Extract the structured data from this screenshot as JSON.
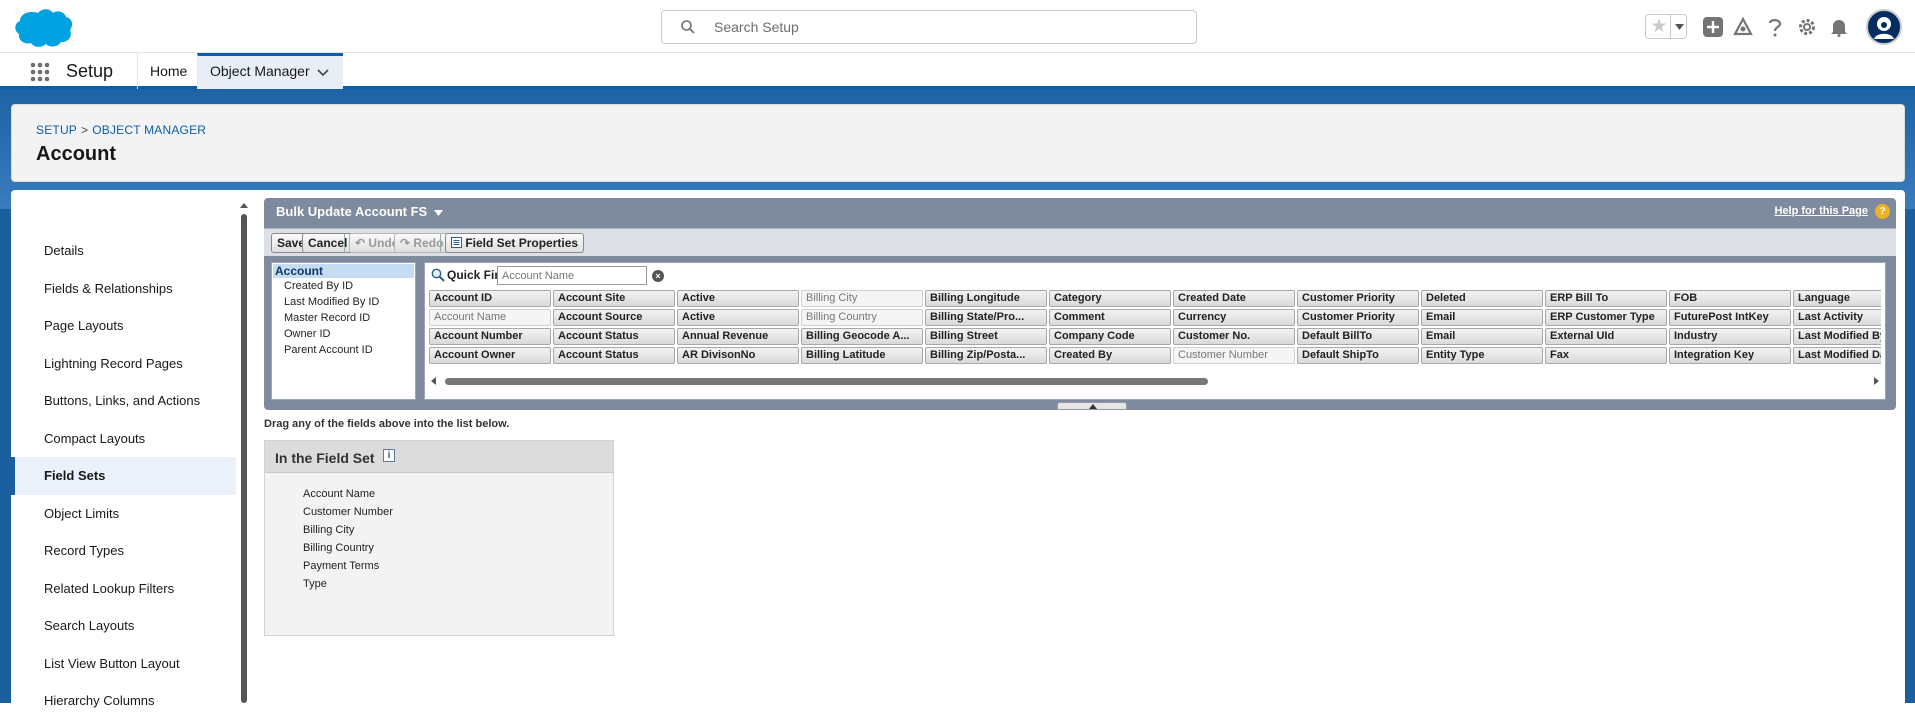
{
  "header": {
    "search_placeholder": "Search Setup"
  },
  "context": {
    "app_name": "Setup",
    "tabs": [
      {
        "label": "Home"
      },
      {
        "label": "Object Manager"
      }
    ]
  },
  "page": {
    "breadcrumb": [
      "SETUP",
      "OBJECT MANAGER"
    ],
    "breadcrumb_separator": ">",
    "title": "Account"
  },
  "sidebar": {
    "items": [
      {
        "label": "Details"
      },
      {
        "label": "Fields & Relationships"
      },
      {
        "label": "Page Layouts"
      },
      {
        "label": "Lightning Record Pages"
      },
      {
        "label": "Buttons, Links, and Actions"
      },
      {
        "label": "Compact Layouts"
      },
      {
        "label": "Field Sets"
      },
      {
        "label": "Object Limits"
      },
      {
        "label": "Record Types"
      },
      {
        "label": "Related Lookup Filters"
      },
      {
        "label": "Search Layouts"
      },
      {
        "label": "List View Button Layout"
      },
      {
        "label": "Hierarchy Columns"
      }
    ],
    "active": "Field Sets"
  },
  "editor": {
    "title": "Bulk Update Account FS",
    "help_link": "Help for this Page",
    "help_icon": "?",
    "toolbar": {
      "save": "Save",
      "cancel": "Cancel",
      "undo": "Undo",
      "redo": "Redo",
      "properties": "Field Set Properties"
    },
    "objects": {
      "header": "Account",
      "items": [
        "Created By ID",
        "Last Modified By ID",
        "Master Record ID",
        "Owner ID",
        "Parent Account ID"
      ]
    },
    "quick_find": {
      "label": "Quick Find",
      "placeholder": "Account Name"
    },
    "fields": [
      [
        "Account ID",
        "Account Name",
        "Account Number",
        "Account Owner"
      ],
      [
        "Account Site",
        "Account Source",
        "Account Status",
        "Account Status"
      ],
      [
        "Active",
        "Active",
        "Annual Revenue",
        "AR DivisonNo"
      ],
      [
        "Billing City",
        "Billing Country",
        "Billing Geocode A...",
        "Billing Latitude"
      ],
      [
        "Billing Longitude",
        "Billing State/Pro...",
        "Billing Street",
        "Billing Zip/Posta..."
      ],
      [
        "Category",
        "Comment",
        "Company Code",
        "Created By"
      ],
      [
        "Created Date",
        "Currency",
        "Customer No.",
        "Customer Number"
      ],
      [
        "Customer Priority",
        "Customer Priority",
        "Default BillTo",
        "Default ShipTo"
      ],
      [
        "Deleted",
        "Email",
        "Email",
        "Entity Type"
      ],
      [
        "ERP Bill To",
        "ERP Customer Type",
        "External UId",
        "Fax"
      ],
      [
        "FOB",
        "FuturePost IntKey",
        "Industry",
        "Integration Key"
      ],
      [
        "Language",
        "Last Activity",
        "Last Modified By",
        "Last Modified Da..."
      ]
    ],
    "used_fields": [
      "Account Name",
      "Billing City",
      "Billing Country",
      "Customer Number"
    ]
  },
  "drag_hint": "Drag any of the fields above into the list below.",
  "fieldset": {
    "title": "In the Field Set",
    "info_icon": "i",
    "items": [
      "Account Name",
      "Customer Number",
      "Billing City",
      "Billing Country",
      "Payment Terms",
      "Type"
    ]
  },
  "colors": {
    "brand_blue": "#0b5cab",
    "background_blue": "#1b5f9e",
    "editor_gray": "#7e8b9e",
    "help_orange": "#f0b01f"
  }
}
